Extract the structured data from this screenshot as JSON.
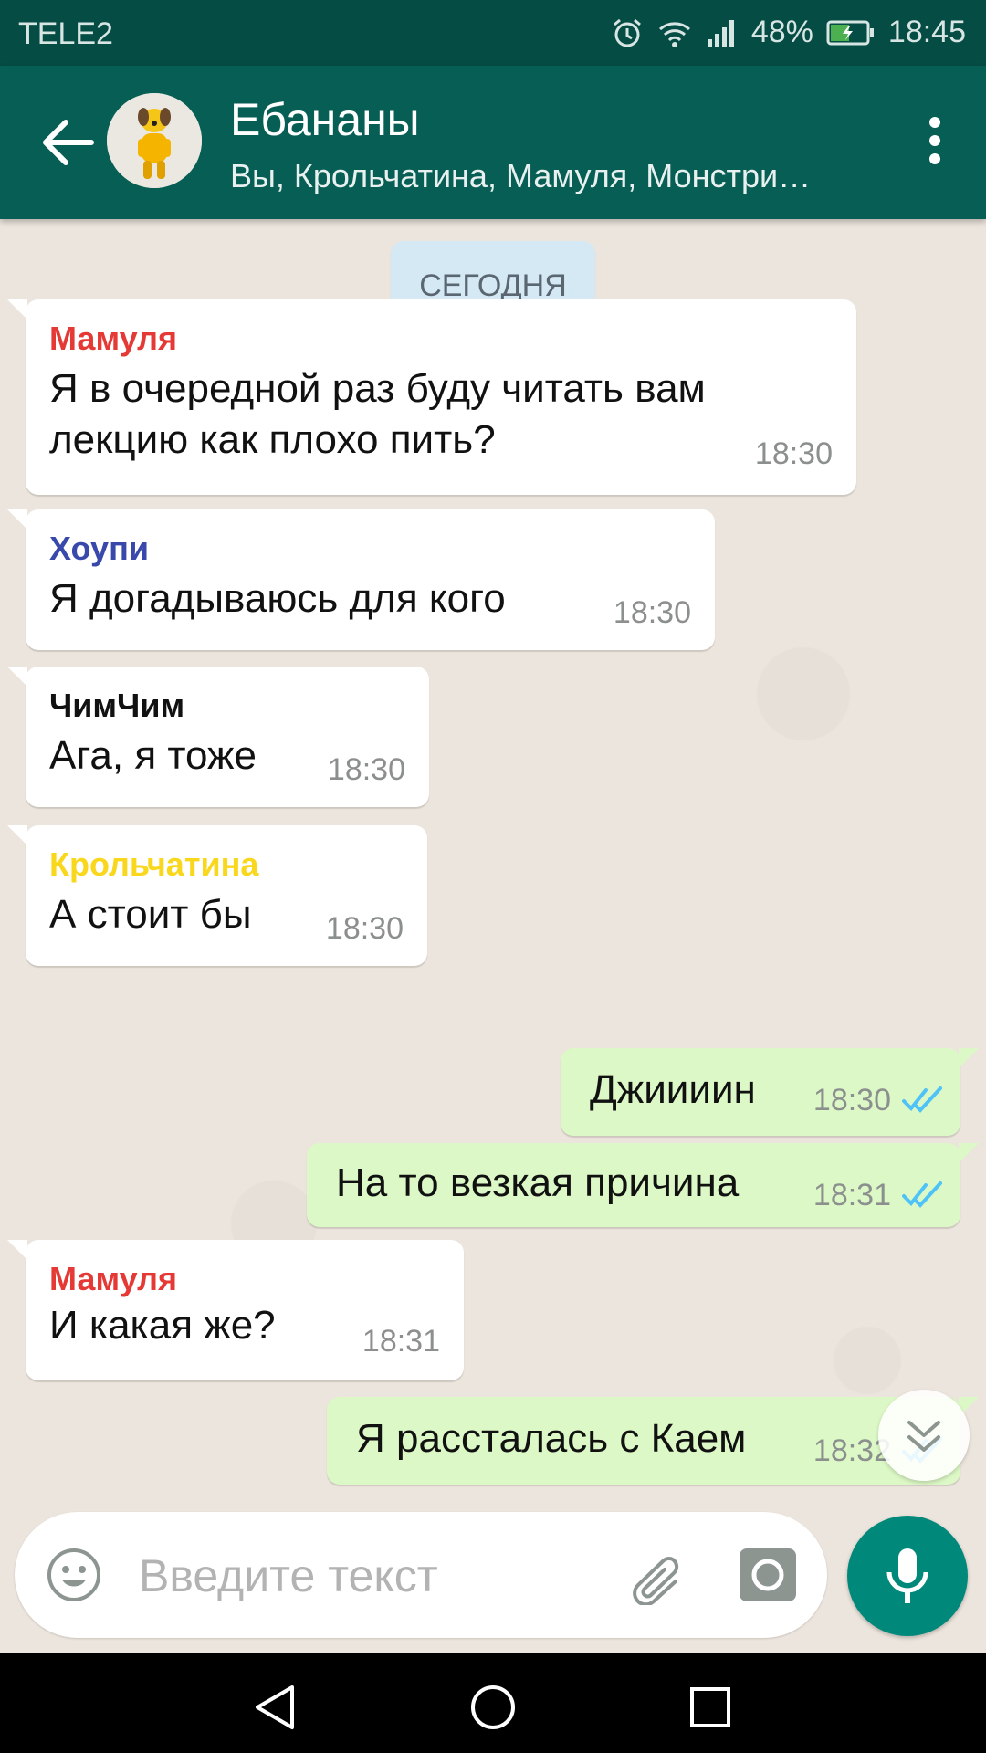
{
  "status_bar": {
    "carrier": "TELE2",
    "battery": "48%",
    "time": "18:45"
  },
  "header": {
    "title": "Ебананы",
    "subtitle": "Вы, Крольчатина, Мамуля, Монстри…"
  },
  "chat": {
    "date_label": "СЕГОДНЯ",
    "messages": [
      {
        "direction": "in",
        "sender": "Мамуля",
        "sender_color": "#e53935",
        "lines": [
          "Я в очередной раз буду читать вам",
          "лекцию как плохо пить?"
        ],
        "time": "18:30"
      },
      {
        "direction": "in",
        "sender": "Хоупи",
        "sender_color": "#3949ab",
        "lines": [
          "Я догадываюсь для кого"
        ],
        "time": "18:30"
      },
      {
        "direction": "in",
        "sender": "ЧимЧим",
        "sender_color": "#111111",
        "lines": [
          "Ага, я тоже"
        ],
        "time": "18:30"
      },
      {
        "direction": "in",
        "sender": "Крольчатина",
        "sender_color": "#f9d71c",
        "lines": [
          "А стоит бы"
        ],
        "time": "18:30"
      },
      {
        "direction": "out",
        "lines": [
          "Джиииин"
        ],
        "time": "18:30",
        "status": "read"
      },
      {
        "direction": "out",
        "lines": [
          "На то везкая причина"
        ],
        "time": "18:31",
        "status": "read"
      },
      {
        "direction": "in",
        "sender": "Мамуля",
        "sender_color": "#e53935",
        "lines": [
          "И какая же?"
        ],
        "time": "18:31"
      },
      {
        "direction": "out",
        "lines": [
          "Я рассталась с Каем"
        ],
        "time": "18:32",
        "status": "read"
      }
    ]
  },
  "input": {
    "placeholder": "Введите текст"
  },
  "colors": {
    "header_bg": "#075e54",
    "status_bar_bg": "#054c44",
    "outgoing_bubble": "#dcf8c6",
    "incoming_bubble": "#ffffff",
    "accent": "#00897b",
    "read_ticks": "#4fc3f7"
  },
  "icons": {
    "header": [
      "back-arrow-icon",
      "group-avatar",
      "more-vert-icon"
    ],
    "input": [
      "emoji-icon",
      "paperclip-icon",
      "camera-icon",
      "mic-icon"
    ],
    "navigation": [
      "nav-back-icon",
      "nav-home-icon",
      "nav-recents-icon"
    ]
  }
}
